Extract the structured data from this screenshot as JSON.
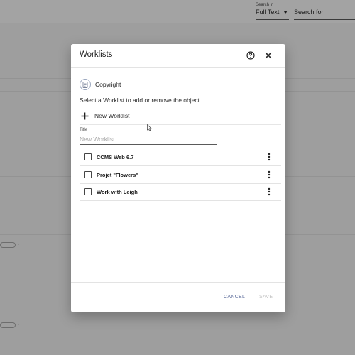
{
  "background": {
    "search_caption": "Search in",
    "search_scope": "Full Text",
    "search_placeholder": "Search for"
  },
  "dialog": {
    "title": "Worklists",
    "object_name": "Copyright",
    "instruction": "Select a Worklist to add or remove the object.",
    "new_worklist_label": "New Worklist",
    "title_field_caption": "Title",
    "title_field_placeholder": "New Worklist",
    "title_field_value": "",
    "worklists": [
      {
        "name": "CCMS Web 6.7",
        "checked": false
      },
      {
        "name": "Projet \"Flowers\"",
        "checked": false
      },
      {
        "name": "Work with Leigh",
        "checked": false
      }
    ],
    "cancel_label": "CANCEL",
    "save_label": "SAVE"
  },
  "colors": {
    "overlay": "#9e9e9e",
    "accent": "#5b6b9a",
    "disabled": "#c2c2c2"
  }
}
